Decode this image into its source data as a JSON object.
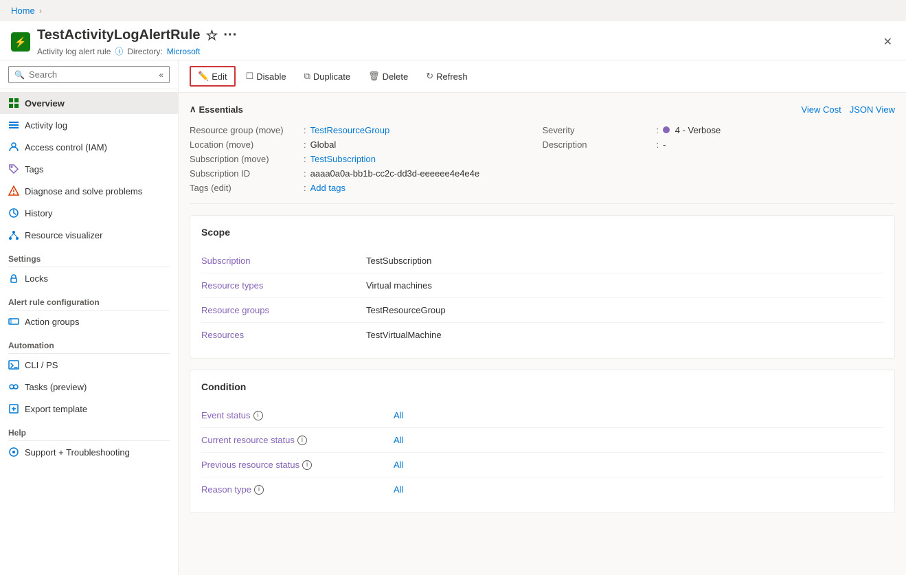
{
  "breadcrumb": {
    "home_label": "Home",
    "chevron": "›"
  },
  "header": {
    "icon_text": "!",
    "title": "TestActivityLogAlertRule",
    "subtitle_type": "Activity log alert rule",
    "subtitle_dir_label": "Directory:",
    "subtitle_dir_value": "Microsoft"
  },
  "toolbar": {
    "edit_label": "Edit",
    "disable_label": "Disable",
    "duplicate_label": "Duplicate",
    "delete_label": "Delete",
    "refresh_label": "Refresh"
  },
  "sidebar": {
    "search_placeholder": "Search",
    "nav_items": [
      {
        "id": "overview",
        "label": "Overview",
        "active": true
      },
      {
        "id": "activity-log",
        "label": "Activity log"
      },
      {
        "id": "access-control",
        "label": "Access control (IAM)"
      },
      {
        "id": "tags",
        "label": "Tags"
      },
      {
        "id": "diagnose",
        "label": "Diagnose and solve problems"
      },
      {
        "id": "history",
        "label": "History"
      },
      {
        "id": "resource-visualizer",
        "label": "Resource visualizer"
      }
    ],
    "settings_section": "Settings",
    "settings_items": [
      {
        "id": "locks",
        "label": "Locks"
      }
    ],
    "alert_section": "Alert rule configuration",
    "alert_items": [
      {
        "id": "action-groups",
        "label": "Action groups"
      }
    ],
    "automation_section": "Automation",
    "automation_items": [
      {
        "id": "cli-ps",
        "label": "CLI / PS"
      },
      {
        "id": "tasks",
        "label": "Tasks (preview)"
      },
      {
        "id": "export-template",
        "label": "Export template"
      }
    ],
    "help_section": "Help",
    "help_items": [
      {
        "id": "support",
        "label": "Support + Troubleshooting"
      }
    ]
  },
  "essentials": {
    "title": "Essentials",
    "view_cost_label": "View Cost",
    "json_view_label": "JSON View",
    "fields": {
      "resource_group_label": "Resource group (move)",
      "resource_group_value": "TestResourceGroup",
      "severity_label": "Severity",
      "severity_value": "4 - Verbose",
      "location_label": "Location (move)",
      "location_value": "Global",
      "description_label": "Description",
      "description_value": "-",
      "subscription_label": "Subscription (move)",
      "subscription_value": "TestSubscription",
      "subscription_id_label": "Subscription ID",
      "subscription_id_value": "aaaa0a0a-bb1b-cc2c-dd3d-eeeeee4e4e4e",
      "tags_label": "Tags (edit)",
      "tags_value": "Add tags"
    }
  },
  "scope_card": {
    "title": "Scope",
    "rows": [
      {
        "label": "Subscription",
        "value": "TestSubscription"
      },
      {
        "label": "Resource types",
        "value": "Virtual machines"
      },
      {
        "label": "Resource groups",
        "value": "TestResourceGroup"
      },
      {
        "label": "Resources",
        "value": "TestVirtualMachine"
      }
    ]
  },
  "condition_card": {
    "title": "Condition",
    "rows": [
      {
        "label": "Event status",
        "value": "All",
        "has_info": true
      },
      {
        "label": "Current resource status",
        "value": "All",
        "has_info": true
      },
      {
        "label": "Previous resource status",
        "value": "All",
        "has_info": true
      },
      {
        "label": "Reason type",
        "value": "All",
        "has_info": true
      }
    ]
  }
}
